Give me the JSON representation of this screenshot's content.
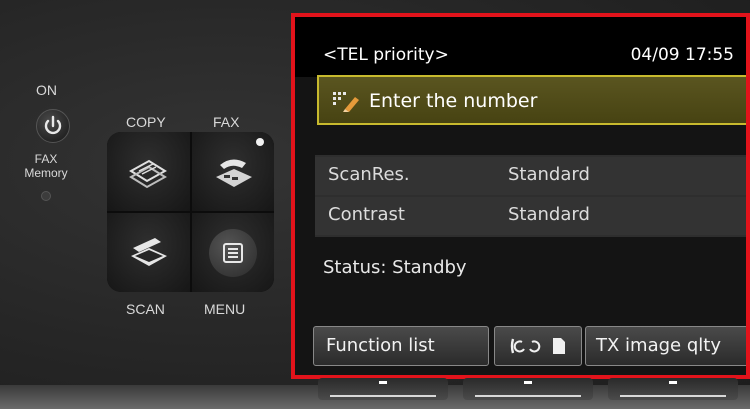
{
  "panel": {
    "power_label": "ON",
    "fax_memory_label_1": "FAX",
    "fax_memory_label_2": "Memory",
    "buttons": {
      "copy": "COPY",
      "fax": "FAX",
      "scan": "SCAN",
      "menu": "MENU"
    }
  },
  "lcd": {
    "mode_title": "<TEL priority>",
    "datetime": "04/09 17:55",
    "prompt": "Enter the number",
    "settings": [
      {
        "key": "ScanRes.",
        "value": "Standard"
      },
      {
        "key": "Contrast",
        "value": "Standard"
      }
    ],
    "status": "Status: Standby",
    "soft_keys": {
      "left": "Function list",
      "right": "TX image qlty"
    }
  },
  "icons": [
    "power-icon",
    "copy-icon",
    "fax-icon",
    "scan-icon",
    "menu-icon",
    "pen-icon",
    "phone-icon",
    "document-icon"
  ],
  "colors": {
    "highlight_border": "#e2131b",
    "field_border": "#c8ba2e",
    "field_bg": "#4d4916"
  }
}
